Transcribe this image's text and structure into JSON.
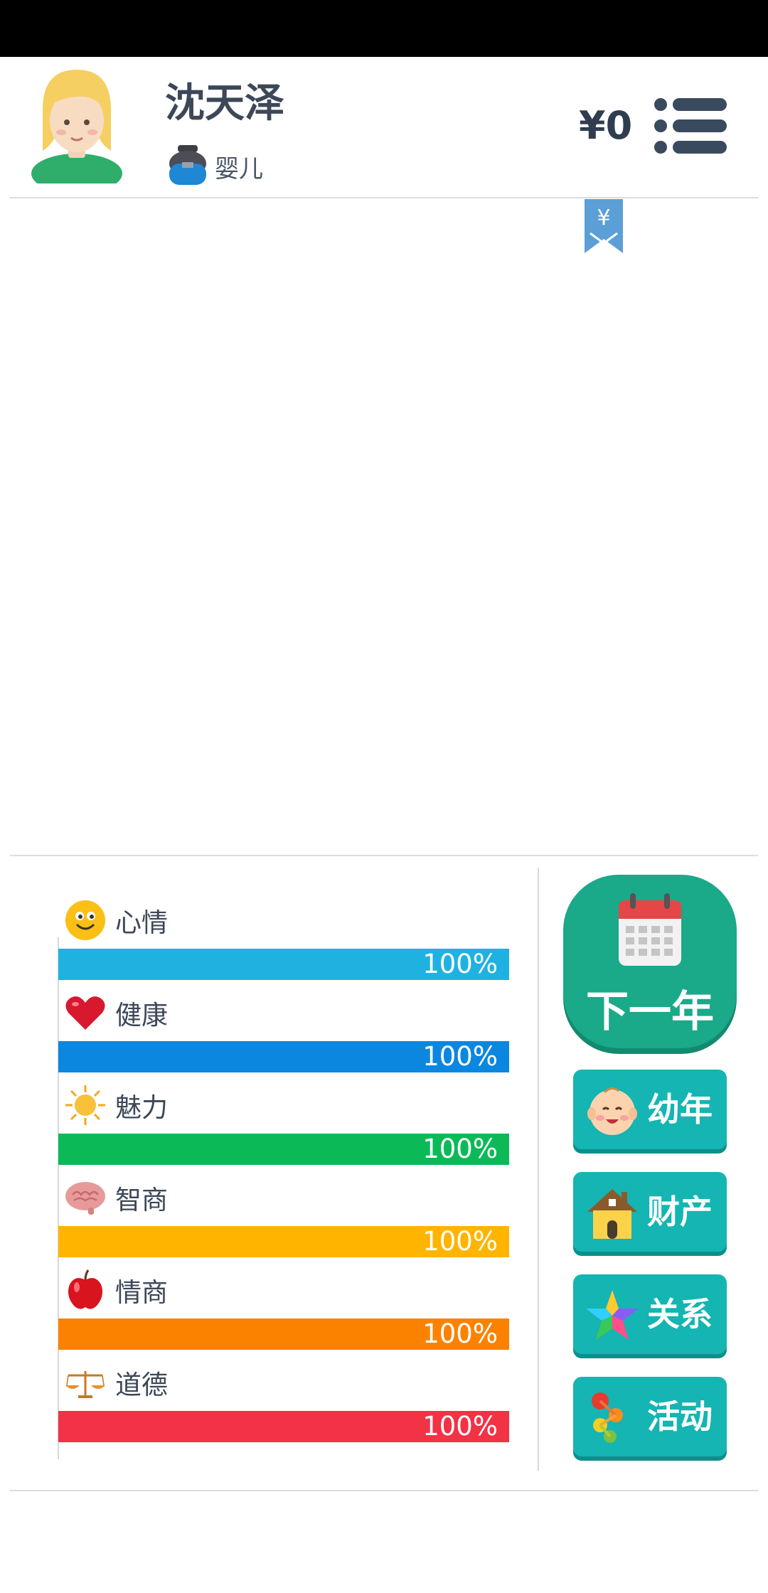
{
  "character": {
    "name": "沈天泽",
    "stage": "婴儿",
    "money": "¥0"
  },
  "stats": [
    {
      "label": "心情",
      "percent_text": "100%",
      "value": 100,
      "color": "#1fb2e0",
      "icon": "smiley-icon"
    },
    {
      "label": "健康",
      "percent_text": "100%",
      "value": 100,
      "color": "#0b87e0",
      "icon": "heart-icon"
    },
    {
      "label": "魅力",
      "percent_text": "100%",
      "value": 100,
      "color": "#0bba57",
      "icon": "sun-icon"
    },
    {
      "label": "智商",
      "percent_text": "100%",
      "value": 100,
      "color": "#ffb400",
      "icon": "brain-icon"
    },
    {
      "label": "情商",
      "percent_text": "100%",
      "value": 100,
      "color": "#fb8200",
      "icon": "apple-icon"
    },
    {
      "label": "道德",
      "percent_text": "100%",
      "value": 100,
      "color": "#f23245",
      "icon": "scales-icon"
    }
  ],
  "actions": {
    "next_year": "下一年",
    "childhood": "幼年",
    "property": "财产",
    "relations": "关系",
    "activities": "活动"
  },
  "colors": {
    "accent_green": "#1aa989",
    "button_teal": "#14b5b2",
    "text_dark": "#3c4858"
  }
}
